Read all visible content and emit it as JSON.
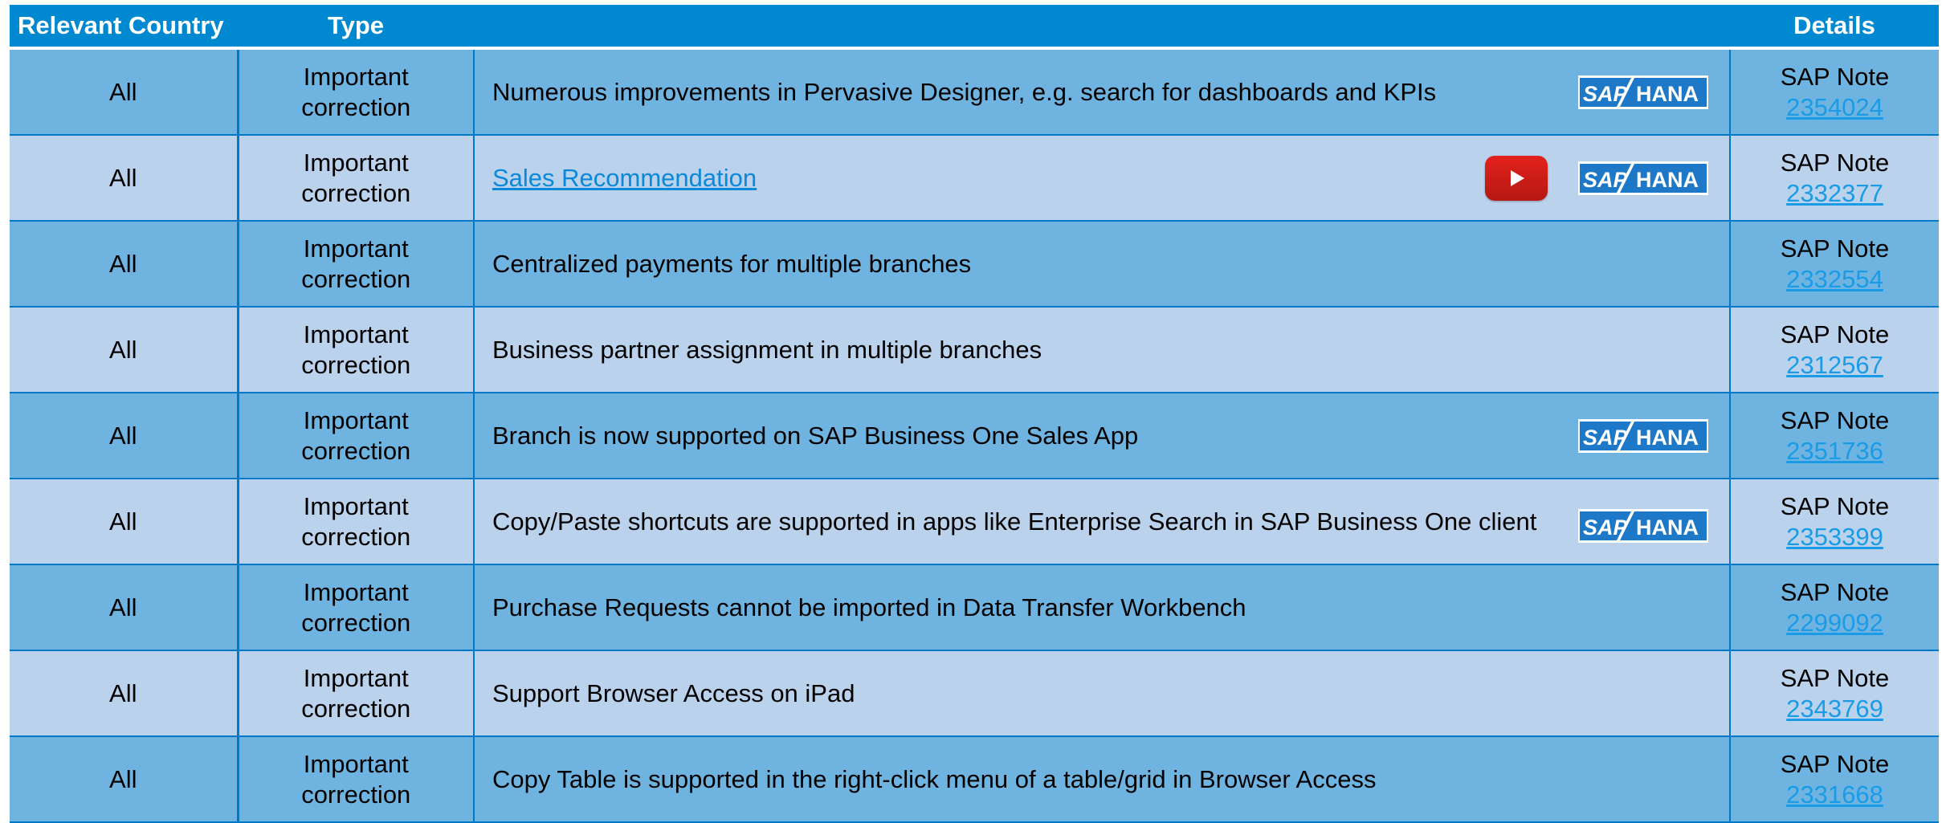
{
  "header": {
    "country": "Relevant Country",
    "type": "Type",
    "description": "",
    "details": "Details"
  },
  "logo": {
    "sap": "SAP",
    "hana": "HANA"
  },
  "colors": {
    "header_bg": "#0088d1",
    "row_dark": "#6fb4e1",
    "row_light": "#bad2ec",
    "link": "#1a9be6",
    "youtube_red": "#e3221c"
  },
  "rows": [
    {
      "country": "All",
      "type_line1": "Important",
      "type_line2": "correction",
      "description": "Numerous improvements in Pervasive Designer, e.g. search for dashboards and KPIs",
      "note_label": "SAP Note",
      "note_number": "2354024"
    },
    {
      "country": "All",
      "type_line1": "Important",
      "type_line2": "correction",
      "description": "Sales Recommendation",
      "note_label": "SAP Note",
      "note_number": "2332377"
    },
    {
      "country": "All",
      "type_line1": "Important",
      "type_line2": "correction",
      "description": "Centralized payments for multiple branches",
      "note_label": "SAP Note",
      "note_number": "2332554"
    },
    {
      "country": "All",
      "type_line1": "Important",
      "type_line2": "correction",
      "description": "Business partner assignment in multiple branches",
      "note_label": "SAP Note",
      "note_number": "2312567"
    },
    {
      "country": "All",
      "type_line1": "Important",
      "type_line2": "correction",
      "description": "Branch is now supported on SAP Business One Sales App",
      "note_label": "SAP Note",
      "note_number": "2351736"
    },
    {
      "country": "All",
      "type_line1": "Important",
      "type_line2": "correction",
      "description": "Copy/Paste shortcuts are supported in apps like Enterprise Search in SAP Business One client",
      "note_label": "SAP Note",
      "note_number": "2353399"
    },
    {
      "country": "All",
      "type_line1": "Important",
      "type_line2": "correction",
      "description": "Purchase Requests cannot be imported in Data Transfer Workbench",
      "note_label": "SAP Note",
      "note_number": "2299092"
    },
    {
      "country": "All",
      "type_line1": "Important",
      "type_line2": "correction",
      "description": "Support Browser Access on iPad",
      "note_label": "SAP Note",
      "note_number": "2343769"
    },
    {
      "country": "All",
      "type_line1": "Important",
      "type_line2": "correction",
      "description": "Copy Table is supported in the right-click menu of a table/grid in Browser Access",
      "note_label": "SAP Note",
      "note_number": "2331668"
    }
  ]
}
